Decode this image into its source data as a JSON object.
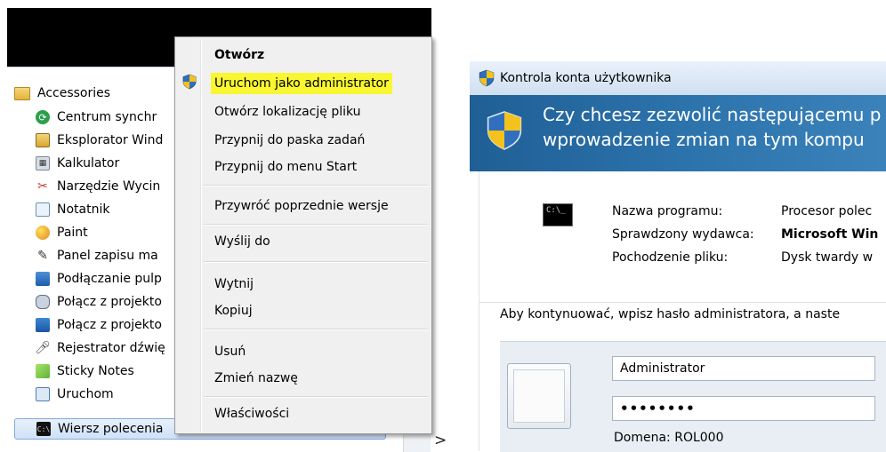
{
  "start_menu": {
    "folder": "Accessories",
    "items": [
      {
        "label": "Centrum synchr",
        "icon": "sync-center-icon"
      },
      {
        "label": "Eksplorator Wind",
        "icon": "windows-explorer-icon"
      },
      {
        "label": "Kalkulator",
        "icon": "calculator-icon"
      },
      {
        "label": "Narzędzie Wycin",
        "icon": "snipping-tool-icon"
      },
      {
        "label": "Notatnik",
        "icon": "notepad-icon"
      },
      {
        "label": "Paint",
        "icon": "paint-icon"
      },
      {
        "label": "Panel zapisu ma",
        "icon": "math-input-panel-icon"
      },
      {
        "label": "Podłączanie pulp",
        "icon": "remote-desktop-icon"
      },
      {
        "label": "Połącz z projekto",
        "icon": "connect-projector-icon"
      },
      {
        "label": "Połącz z projekto",
        "icon": "connect-network-projector-icon"
      },
      {
        "label": "Rejestrator dźwię",
        "icon": "sound-recorder-icon"
      },
      {
        "label": "Sticky Notes",
        "icon": "sticky-notes-icon"
      },
      {
        "label": "Uruchom",
        "icon": "run-icon"
      }
    ],
    "selected_item": {
      "label": "Wiersz polecenia",
      "icon": "command-prompt-icon"
    },
    "arrow": ">"
  },
  "context_menu": {
    "open": "Otwórz",
    "run_as_admin": "Uruchom jako administrator",
    "open_location": "Otwórz lokalizację pliku",
    "pin_taskbar": "Przypnij do paska zadań",
    "pin_start": "Przypnij do menu Start",
    "restore_versions": "Przywróć poprzednie wersje",
    "send_to": "Wyślij do",
    "cut": "Wytnij",
    "copy": "Kopiuj",
    "delete": "Usuń",
    "rename": "Zmień nazwę",
    "properties": "Właściwości",
    "highlight_color": "#f9f632"
  },
  "uac": {
    "title": "Kontrola konta użytkownika",
    "question_line1": "Czy chcesz zezwolić następującemu p",
    "question_line2": "wprowadzenie zmian na tym kompu",
    "program_icon_text": "C:\\_",
    "program_name_label": "Nazwa programu:",
    "program_name_value": "Procesor polec",
    "publisher_label": "Sprawdzony wydawca:",
    "publisher_value": "Microsoft Win",
    "origin_label": "Pochodzenie pliku:",
    "origin_value": "Dysk twardy w",
    "instruction": "Aby kontynuować, wpisz hasło administratora, a naste",
    "username": "Administrator",
    "password": "••••••••",
    "domain": "Domena: ROL000",
    "banner_color": "#2d74ad"
  }
}
